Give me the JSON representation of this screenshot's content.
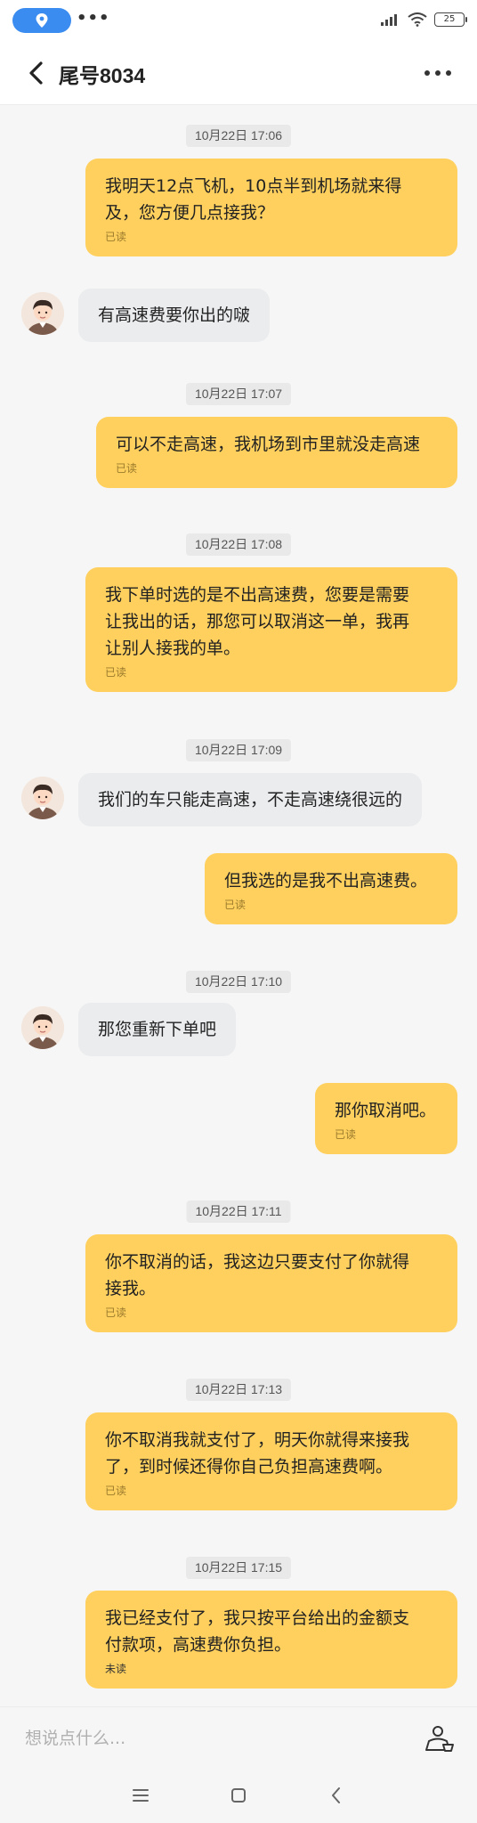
{
  "header": {
    "title": "尾号8034"
  },
  "statusbar": {
    "battery": "25"
  },
  "messages": [
    {
      "time": "10月22日 17:06"
    },
    {
      "text": "我明天12点飞机，10点半到机场就来得及，您方便几点接我？",
      "line1": "我明天12点飞机，10点半到机场就来得",
      "line2": "及，您方便几点接我？",
      "state": "已读"
    },
    {
      "text": "有高速费要你出的啵"
    },
    {
      "time": "10月22日 17:07"
    },
    {
      "text": "可以不走高速，我机场到市里就没走高速",
      "state": "已读"
    },
    {
      "time": "10月22日 17:08"
    },
    {
      "text": "我下单时选的是不出高速费，您要是需要让我出的话，那您可以取消这一单，我再让别人接我的单。",
      "line1": "我下单时选的是不出高速费，您要是需要",
      "line2": "让我出的话，那您可以取消这一单，我再",
      "line3": "让别人接我的单。",
      "state": "已读"
    },
    {
      "time": "10月22日 17:09"
    },
    {
      "text": "我们的车只能走高速，不走高速绕很远的"
    },
    {
      "text": "但我选的是我不出高速费。",
      "state": "已读"
    },
    {
      "time": "10月22日 17:10"
    },
    {
      "text": "那您重新下单吧"
    },
    {
      "text": "那你取消吧。",
      "state": "已读"
    },
    {
      "time": "10月22日 17:11"
    },
    {
      "text": "你不取消的话，我这边只要支付了你就得接我。",
      "line1": "你不取消的话，我这边只要支付了你就得",
      "line2": "接我。",
      "state": "已读"
    },
    {
      "time": "10月22日 17:13"
    },
    {
      "text": "你不取消我就支付了，明天你就得来接我了，到时候还得你自己负担高速费啊。",
      "line1": "你不取消我就支付了，明天你就得来接我",
      "line2": "了，到时候还得你自己负担高速费啊。",
      "state": "已读"
    },
    {
      "time": "10月22日 17:15"
    },
    {
      "text": "我已经支付了，我只按平台给出的金额支付款项，高速费你负担。",
      "line1": "我已经支付了，我只按平台给出的金额支",
      "line2": "付款项，高速费你负担。",
      "state": "未读"
    }
  ],
  "input": {
    "placeholder": "想说点什么..."
  },
  "colors": {
    "outgoing_bubble": "#ffd05e",
    "incoming_bubble": "#ebecee",
    "location_pill": "#3b8cf0"
  },
  "icons": [
    "location-icon",
    "wifi-icon",
    "signal-icon",
    "battery-icon",
    "back-arrow-icon",
    "more-icon",
    "emoji-icon",
    "menu-icon",
    "home-icon",
    "back-icon"
  ]
}
